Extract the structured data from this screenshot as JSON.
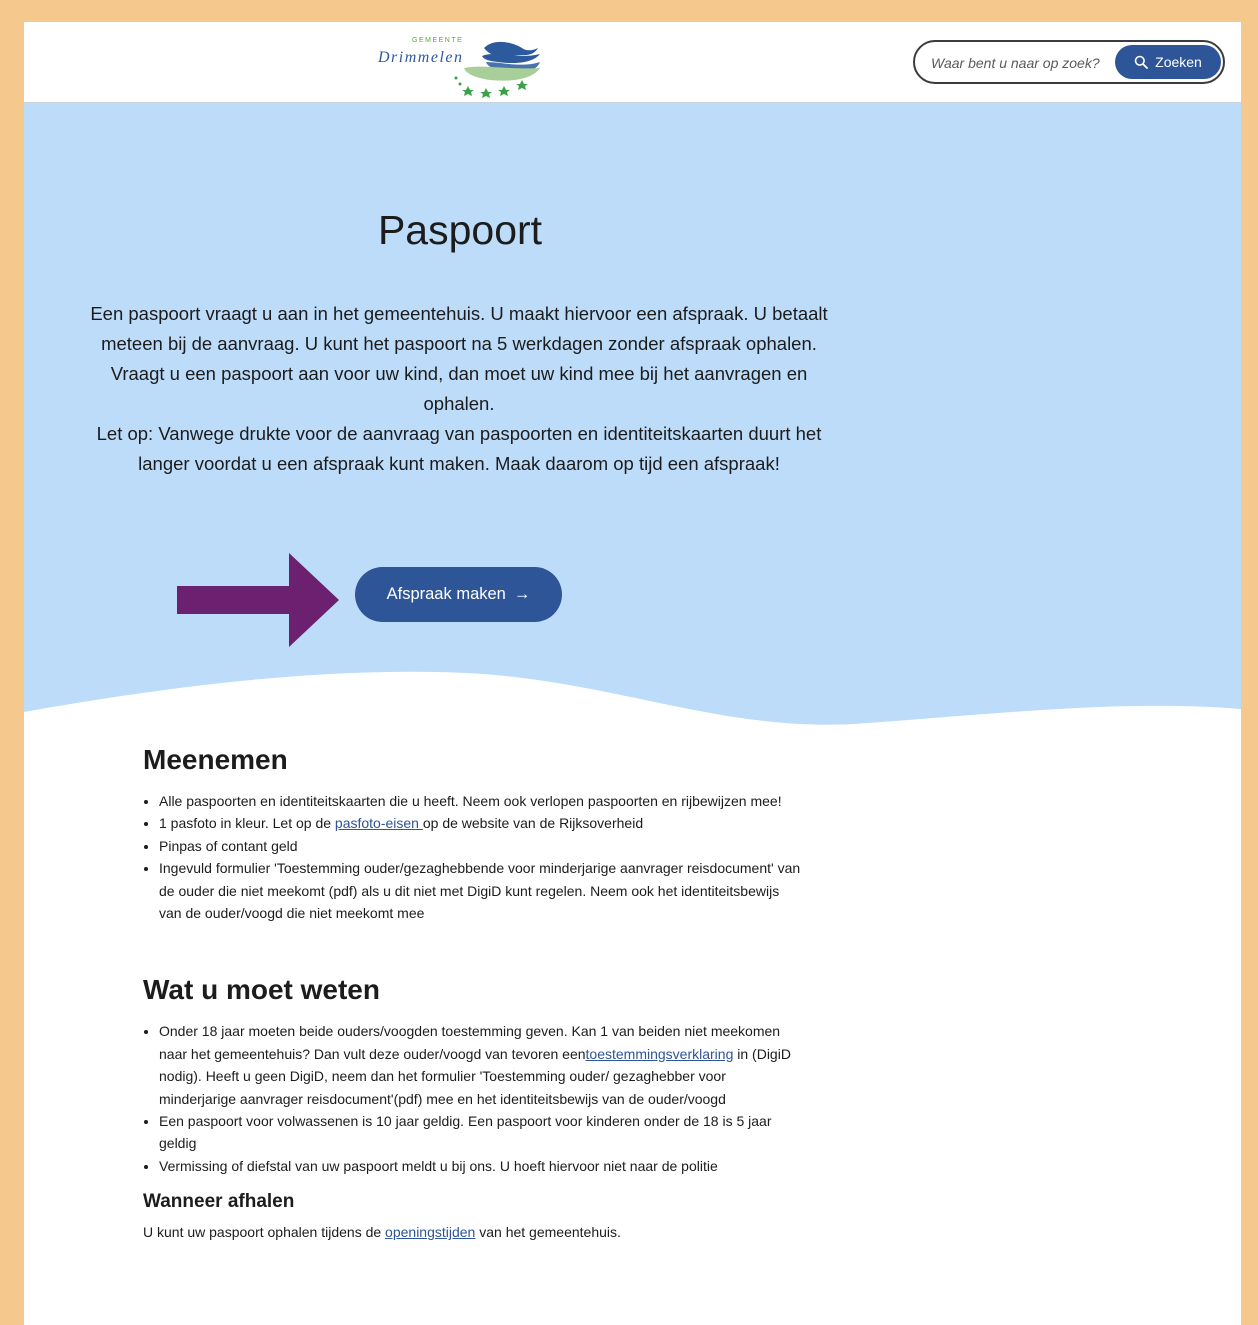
{
  "header": {
    "logo_small": "GEMEENTE",
    "logo_name": "Drimmelen",
    "search_placeholder": "Waar bent u naar op zoek?",
    "search_button": "Zoeken"
  },
  "hero": {
    "title": "Paspoort",
    "intro_1": "Een paspoort vraagt u aan in het gemeentehuis. U maakt hiervoor een afspraak. U betaalt meteen bij de aanvraag. U kunt het paspoort na 5 werkdagen zonder afspraak ophalen. Vraagt u een paspoort aan voor uw kind, dan moet uw kind mee bij het aanvragen en ophalen.",
    "intro_2": "Let op: Vanwege drukte voor de aanvraag van paspoorten en identiteitskaarten duurt het langer voordat u een afspraak kunt maken. Maak daarom op tijd een afspraak!",
    "cta_label": "Afspraak maken",
    "cta_arrow": "→"
  },
  "meenemen": {
    "heading": "Meenemen",
    "item1": "Alle paspoorten en identiteitskaarten die u heeft. Neem ook verlopen paspoorten en rijbewijzen mee!",
    "item2_pre": "1 pasfoto in kleur. Let op de ",
    "item2_link": "pasfoto-eisen ",
    "item2_post": "op de website van de Rijksoverheid",
    "item3": "Pinpas of contant geld",
    "item4": "Ingevuld formulier 'Toestemming ouder/gezaghebbende voor minderjarige aanvrager reisdocument' van de ouder die niet meekomt (pdf) als u dit niet met DigiD kunt regelen. Neem ook het identiteitsbewijs van de ouder/voogd die niet meekomt mee"
  },
  "weten": {
    "heading": "Wat u moet weten",
    "item1_pre": "Onder 18 jaar moeten beide ouders/voogden toestemming geven. Kan 1 van beiden niet meekomen naar het gemeentehuis? Dan vult deze ouder/voogd van tevoren een",
    "item1_link": "toestemmingsverklaring",
    "item1_post": "in (DigiD nodig). Heeft u geen DigiD, neem dan het formulier 'Toestemming ouder/ gezaghebber voor minderjarige aanvrager reisdocument'(pdf) mee en het identiteitsbewijs van de ouder/voogd",
    "item2": "Een paspoort voor volwassenen is 10 jaar geldig. Een paspoort voor kinderen onder de 18 is 5 jaar geldig",
    "item3": "Vermissing of diefstal van uw paspoort meldt u bij ons. U hoeft hiervoor niet naar de politie"
  },
  "afhalen": {
    "heading": "Wanneer afhalen",
    "text_pre": "U kunt uw paspoort ophalen tijdens de ",
    "text_link": "openingstijden",
    "text_post": " van het gemeentehuis."
  },
  "colors": {
    "hero_bg": "#bddcf9",
    "button": "#2e5597",
    "arrow": "#6b2170",
    "frame": "#f5c98e"
  },
  "icons": [
    "search-icon",
    "arrow-right-icon",
    "annotation-arrow",
    "logo"
  ]
}
